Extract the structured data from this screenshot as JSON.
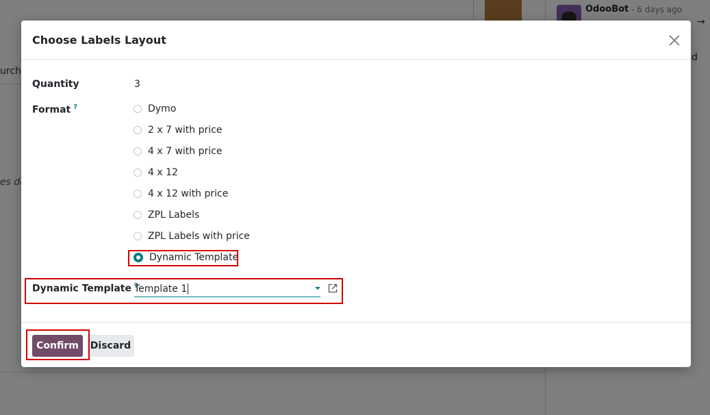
{
  "background": {
    "purchase_fragment": "urcha",
    "italic_fragment": "es de",
    "chatter_author": "OdooBot",
    "chatter_time": "- 6 days ago",
    "chatter_arrow": "→",
    "chatter_char": "d"
  },
  "modal": {
    "title": "Choose Labels Layout",
    "quantity_label": "Quantity",
    "quantity_value": "3",
    "format_label": "Format",
    "help_mark": "?",
    "format_options": [
      {
        "label": "Dymo",
        "checked": false
      },
      {
        "label": "2 x 7 with price",
        "checked": false
      },
      {
        "label": "4 x 7 with price",
        "checked": false
      },
      {
        "label": "4 x 12",
        "checked": false
      },
      {
        "label": "4 x 12 with price",
        "checked": false
      },
      {
        "label": "ZPL Labels",
        "checked": false
      },
      {
        "label": "ZPL Labels with price",
        "checked": false
      },
      {
        "label": "Dynamic Template",
        "checked": true
      }
    ],
    "dynamic_template_label": "Dynamic Template",
    "dynamic_template_value": "Template 1",
    "confirm_label": "Confirm",
    "discard_label": "Discard"
  },
  "colors": {
    "primary": "#714b67",
    "accent": "#017e84",
    "highlight": "#d40000"
  }
}
